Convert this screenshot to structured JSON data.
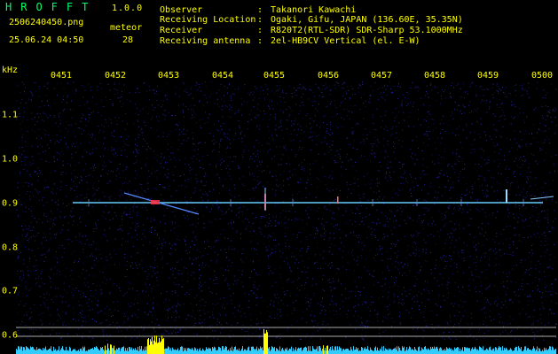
{
  "header": {
    "brand": "HROFFT",
    "version": "1.0.0",
    "filename": "2506240450.png",
    "meteor_label": "meteor",
    "datetime": "25.06.24 04:50",
    "meteor_count": "28"
  },
  "station_info": [
    {
      "label": "Observer",
      "value": "Takanori Kawachi"
    },
    {
      "label": "Receiving Location",
      "value": "Ogaki, Gifu, JAPAN (136.60E, 35.35N)"
    },
    {
      "label": "Receiver",
      "value": "R820T2(RTL-SDR) SDR-Sharp 53.1000MHz"
    },
    {
      "label": "Receiving antenna",
      "value": "2el-HB9CV Vertical (el. E-W)"
    }
  ],
  "plot": {
    "unit_label": "kHz",
    "time_ticks": [
      "0451",
      "0452",
      "0453",
      "0454",
      "0455",
      "0456",
      "0457",
      "0458",
      "0459",
      "0500"
    ],
    "freq_ticks": [
      "1.1",
      "1.0",
      "0.9",
      "0.8",
      "0.7",
      "0.6"
    ],
    "carrier_freq_khz": 0.9,
    "colors": {
      "background": "#000000",
      "noise": "#1a1a7a",
      "carrier": "#66ccff",
      "echo_red": "#ff3344",
      "grid": "#555555",
      "text": "#ffff00",
      "spectrum_base": "#33ccff",
      "spectrum_peak": "#ffff00"
    }
  }
}
